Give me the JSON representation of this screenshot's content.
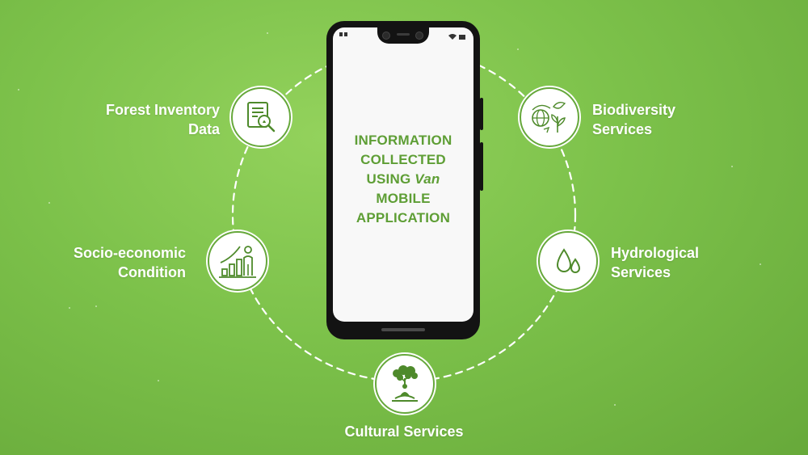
{
  "diagram": {
    "center_title": {
      "line1": "INFORMATION",
      "line2": "COLLECTED",
      "line3_prefix": "USING ",
      "line3_app": "Van",
      "line4": "MOBILE",
      "line5": "APPLICATION"
    },
    "nodes": [
      {
        "id": "forest-inventory",
        "label_line1": "Forest Inventory",
        "label_line2": "Data",
        "icon": "document-magnifier-icon"
      },
      {
        "id": "biodiversity",
        "label_line1": "Biodiversity",
        "label_line2": "Services",
        "icon": "globe-bird-plant-icon"
      },
      {
        "id": "socio-economic",
        "label_line1": "Socio-economic",
        "label_line2": "Condition",
        "icon": "person-growth-chart-icon"
      },
      {
        "id": "hydrological",
        "label_line1": "Hydrological",
        "label_line2": "Services",
        "icon": "water-drops-icon"
      },
      {
        "id": "cultural",
        "label_line1": "Cultural Services",
        "label_line2": "",
        "icon": "meditating-person-tree-icon"
      }
    ]
  },
  "colors": {
    "background": "#7cc14a",
    "accent_green": "#5e9e35",
    "icon_green": "#4e8a2b",
    "label_white": "#ffffff",
    "phone_body": "#131313"
  }
}
